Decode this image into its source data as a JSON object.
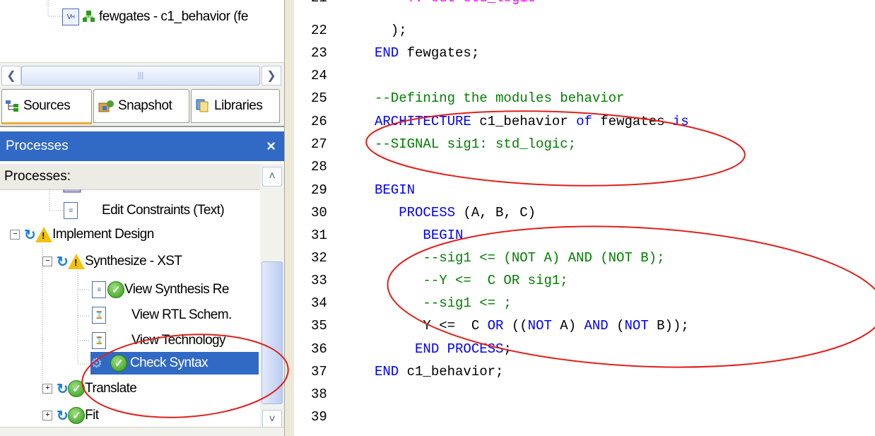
{
  "sources_tree": {
    "item_label": "fewgates - c1_behavior (fe"
  },
  "tabs": [
    {
      "label": "Sources",
      "active": true
    },
    {
      "label": "Snapshot"
    },
    {
      "label": "Libraries"
    }
  ],
  "processes_panel": {
    "title": "Processes",
    "close_glyph": "×",
    "label": "Processes:",
    "items": [
      {
        "label": "Edit Constraints (Text)"
      },
      {
        "label": "Implement Design"
      },
      {
        "label": "Synthesize - XST"
      },
      {
        "label": "View Synthesis Re"
      },
      {
        "label": "View RTL Schem."
      },
      {
        "label": "View Technology"
      },
      {
        "label": "Check Syntax",
        "selected": true
      },
      {
        "label": "Translate"
      },
      {
        "label": "Fit"
      }
    ]
  },
  "editor": {
    "line_numbers": [
      "21",
      "22",
      "23",
      "24",
      "25",
      "26",
      "27",
      "28",
      "29",
      "30",
      "31",
      "32",
      "33",
      "34",
      "35",
      "36",
      "37",
      "38",
      "39"
    ],
    "line21": "    Y: out std_logic",
    "line22": "  );",
    "line23_kw": "END",
    "line23_id": " fewgates;",
    "line25": "--Defining the modules behavior",
    "line26_kw": "ARCHITECTURE",
    "line26_id": " c1_behavior ",
    "line26_of": "of",
    "line26_id2": " fewgates ",
    "line26_is": "is",
    "line27": "--SIGNAL sig1: std_logic;",
    "line29": "BEGIN",
    "line30_kw": "   PROCESS",
    "line30_id": " (A, B, C)",
    "line31": "      BEGIN",
    "line32": "      --sig1 <= (NOT A) AND (NOT B);",
    "line33": "      --Y <=  C OR sig1;",
    "line34": "      --sig1 <= ;",
    "line35_a": "      Y <=  C ",
    "line35_or": "OR",
    "line35_b": " ((",
    "line35_not1": "NOT",
    "line35_c": " A) ",
    "line35_and": "AND",
    "line35_d": " (",
    "line35_not2": "NOT",
    "line35_e": " B));",
    "line36_kw": "     END PROCESS",
    "line36_id": ";",
    "line37_kw": "END",
    "line37_id": " c1_behavior;"
  },
  "colors": {
    "keyword": "#0000ff",
    "comment": "#008000",
    "type": "#ff00ff",
    "annotation": "#e0201b",
    "selection": "#316ac5"
  }
}
